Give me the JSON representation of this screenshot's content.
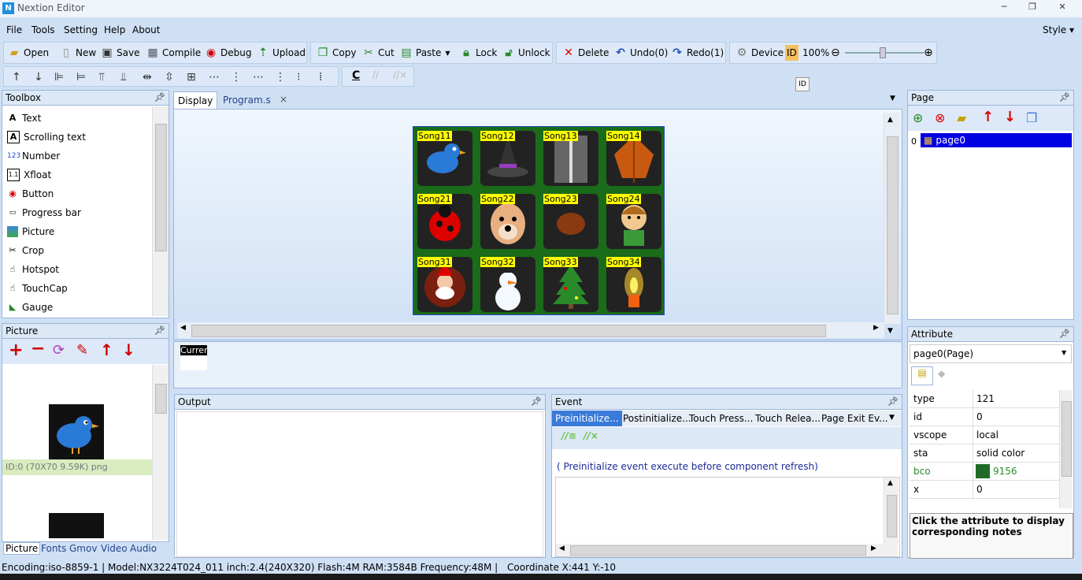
{
  "window": {
    "title": "Nextion Editor",
    "app_icon_text": "N",
    "minimize": "─",
    "maximize": "❐",
    "close": "✕"
  },
  "menubar": {
    "items": [
      "File",
      "Tools",
      "Setting",
      "Help",
      "About"
    ],
    "style": "Style ▾"
  },
  "toolbar1": {
    "open": "Open",
    "new": "New",
    "save": "Save",
    "compile": "Compile",
    "debug": "Debug",
    "upload": "Upload",
    "copy": "Copy",
    "cut": "Cut",
    "paste": "Paste",
    "lock": "Lock",
    "unlock": "Unlock",
    "delete": "Delete",
    "undo": "Undo(0)",
    "redo": "Redo(1)",
    "device": "Device",
    "id": "ID",
    "zoom": "100%"
  },
  "toolbar2": {
    "c_label": "C"
  },
  "id_tooltip": "ID",
  "toolbox": {
    "title": "Toolbox",
    "items": [
      "Text",
      "Scrolling text",
      "Number",
      "Xfloat",
      "Button",
      "Progress bar",
      "Picture",
      "Crop",
      "Hotspot",
      "TouchCap",
      "Gauge"
    ]
  },
  "picture_panel": {
    "title": "Picture",
    "caption": "ID:0  (70X70 9.59K) png"
  },
  "bottom_tabs": [
    "Picture",
    "Fonts",
    "Gmov",
    "Video",
    "Audio"
  ],
  "editor_tabs": {
    "display": "Display",
    "program": "Program.s",
    "close": "×"
  },
  "screen": {
    "buttons": [
      "Song11",
      "Song12",
      "Song13",
      "Song14",
      "Song21",
      "Song22",
      "Song23",
      "Song24",
      "Song31",
      "Song32",
      "Song33",
      "Song34"
    ],
    "bg_color": "#1a6b1a"
  },
  "current_label": "Currer",
  "output": {
    "title": "Output"
  },
  "event": {
    "title": "Event",
    "tabs": [
      "Preinitialize...",
      "Postinitialize...",
      "Touch Press...",
      "Touch Relea...",
      "Page Exit Ev..."
    ],
    "note": "( Preinitialize event execute before component refresh)"
  },
  "page_panel": {
    "title": "Page",
    "index": "0",
    "page_name": "page0"
  },
  "attribute": {
    "title": "Attribute",
    "selector": "page0(Page)",
    "rows": [
      {
        "k": "type",
        "v": "121"
      },
      {
        "k": "id",
        "v": "0"
      },
      {
        "k": "vscope",
        "v": "local"
      },
      {
        "k": "sta",
        "v": "solid color"
      },
      {
        "k": "bco",
        "v": "9156"
      },
      {
        "k": "x",
        "v": "0"
      }
    ],
    "bco_color": "#1f6b26",
    "note": "Click the attribute to display corresponding notes"
  },
  "status": {
    "text": "Encoding:iso-8859-1 | Model:NX3224T024_011 inch:2.4(240X320) Flash:4M RAM:3584B Frequency:48M |",
    "coord": "Coordinate X:441  Y:-10"
  }
}
